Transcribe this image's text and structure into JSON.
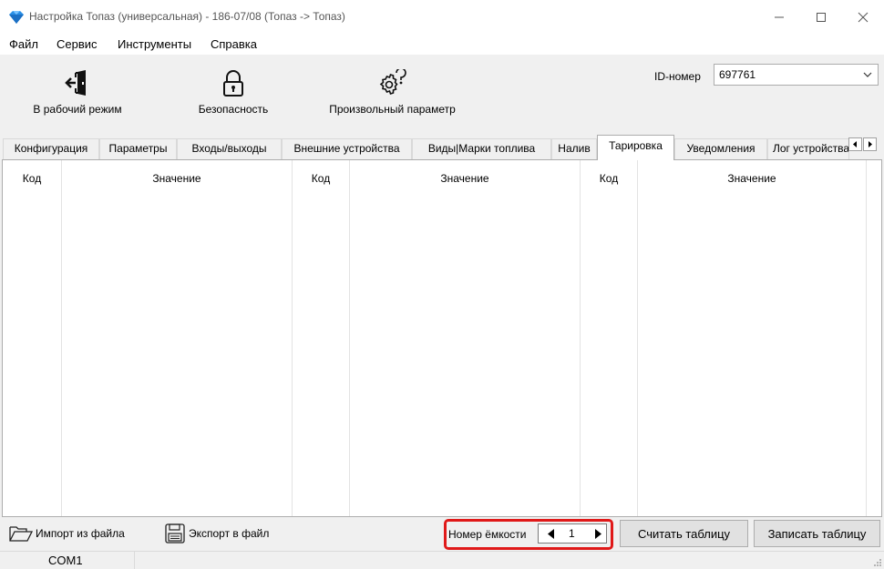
{
  "window": {
    "title": "Настройка Топаз (универсальная) - 186-07/08 (Топаз -> Топаз)",
    "app_icon": "gem-icon",
    "accent_color": "#1e90ff"
  },
  "menu": [
    "Файл",
    "Сервис",
    "Инструменты",
    "Справка"
  ],
  "toolbar": {
    "work_mode": {
      "label": "В рабочий режим",
      "icon": "exit-door-icon"
    },
    "security": {
      "label": "Безопасность",
      "icon": "padlock-icon"
    },
    "custom_param": {
      "label": "Произвольный параметр",
      "icon": "gears-question-icon"
    },
    "id_label": "ID-номер",
    "id_value": "697761"
  },
  "tabs": [
    "Конфигурация",
    "Параметры",
    "Входы/выходы",
    "Внешние устройства",
    "Виды|Марки топлива",
    "Налив",
    "Тарировка",
    "Уведомления",
    "Лог устройства"
  ],
  "active_tab": "Тарировка",
  "table": {
    "headers": [
      "Код",
      "Значение",
      "Код",
      "Значение",
      "Код",
      "Значение"
    ],
    "rows": []
  },
  "bottom": {
    "import_label": "Импорт из файла",
    "export_label": "Экспорт в файл",
    "capacity_label": "Номер ёмкости",
    "capacity_value": "1",
    "read_label": "Считать таблицу",
    "write_label": "Записать таблицу",
    "highlight_color": "#e01919"
  },
  "status": {
    "port": "COM1"
  }
}
